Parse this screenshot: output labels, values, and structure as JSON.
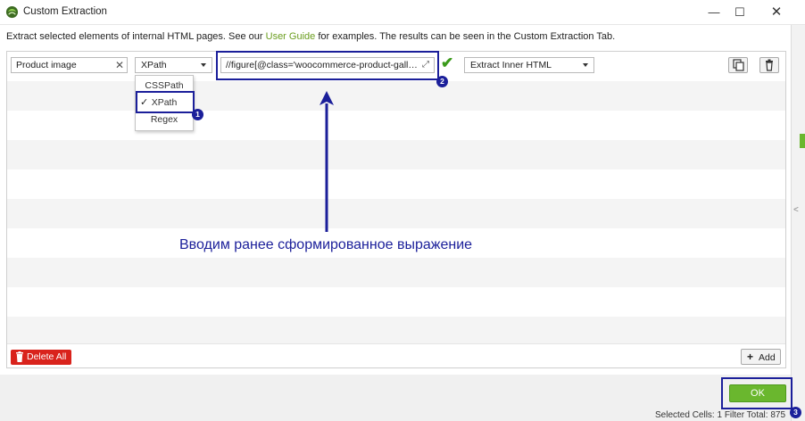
{
  "window": {
    "title": "Custom Extraction",
    "minimize_glyph": "—",
    "maximize_glyph": "☐",
    "close_glyph": "✕"
  },
  "instructions": {
    "prefix": "Extract selected elements of internal HTML pages. See our ",
    "link": "User Guide",
    "suffix": " for examples. The results can be seen in the Custom Extraction Tab."
  },
  "extractor_row": {
    "name_value": "Product image",
    "clear_glyph": "✕",
    "type_selected": "XPath",
    "type_options": [
      "CSSPath",
      "XPath",
      "Regex"
    ],
    "expression_value": "//figure[@class='woocommerce-product-gallery...",
    "expand_glyph": "⤢",
    "valid_glyph": "✔",
    "extract_mode": "Extract Inner HTML"
  },
  "buttons": {
    "delete_all": "Delete All",
    "add_plus": "+",
    "add": "Add",
    "ok": "OK"
  },
  "status": {
    "text": "Selected Cells: 1  Filter Total: 875"
  },
  "annotations": {
    "badge_1": "1",
    "badge_2": "2",
    "badge_3": "3",
    "caption": "Вводим ранее сформированное выражение",
    "color": "#1b1f9a"
  },
  "colors": {
    "accent_green": "#6ab72e",
    "link_green": "#6a9d1e",
    "delete_red": "#d9231c"
  }
}
